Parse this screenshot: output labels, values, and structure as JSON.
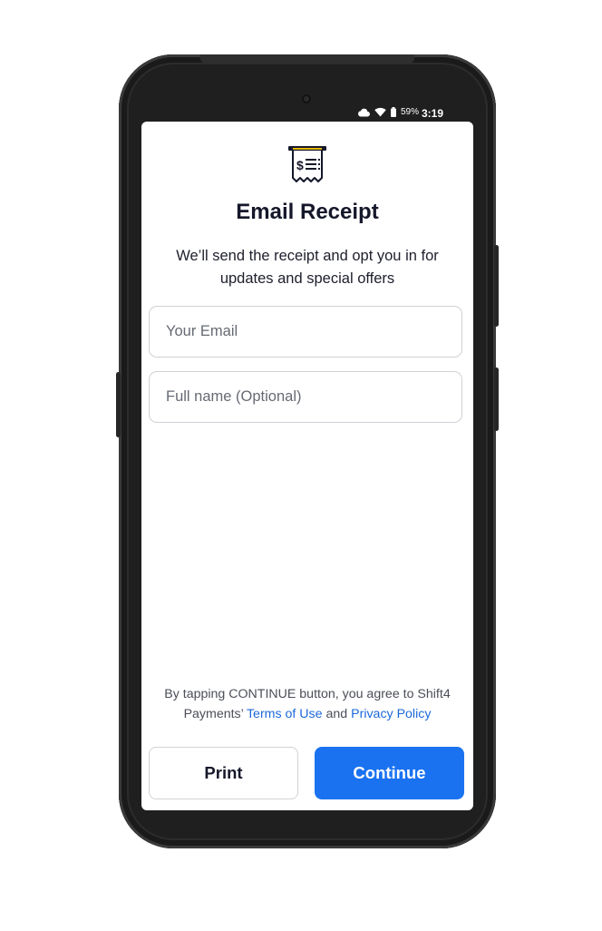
{
  "status_bar": {
    "battery_percent": "59%",
    "time": "3:19",
    "icons": [
      "cloud-icon",
      "wifi-icon",
      "battery-icon"
    ]
  },
  "header": {
    "icon": "receipt-icon",
    "title": "Email Receipt",
    "subtitle": "We’ll send the receipt and opt you in for updates and special offers"
  },
  "form": {
    "email": {
      "placeholder": "Your Email",
      "value": ""
    },
    "full_name": {
      "placeholder": "Full name (Optional)",
      "value": ""
    }
  },
  "legal": {
    "prefix": "By tapping CONTINUE button, you agree to Shift4 Payments’",
    "terms_link": "Terms of Use",
    "connector": "and",
    "privacy_link": "Privacy Policy"
  },
  "actions": {
    "print_label": "Print",
    "continue_label": "Continue"
  },
  "colors": {
    "accent": "#1a72f0",
    "link": "#1b68d9",
    "title": "#15172a"
  }
}
